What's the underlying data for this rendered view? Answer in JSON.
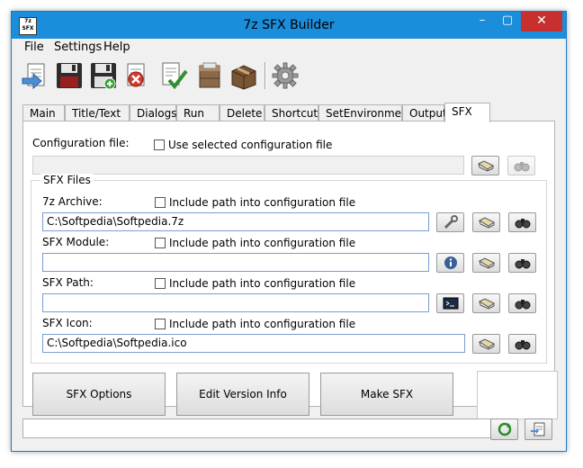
{
  "window": {
    "title": "7z SFX Builder",
    "app_icon_text": "7z SFX"
  },
  "titlebar_buttons": {
    "minimize": "–",
    "maximize": "▢",
    "close": "✕"
  },
  "menu": [
    {
      "label": "File"
    },
    {
      "label": "Settings"
    },
    {
      "label": "Help"
    }
  ],
  "toolbar": [
    {
      "icon": "open-icon"
    },
    {
      "icon": "save-icon"
    },
    {
      "icon": "save-new-icon"
    },
    {
      "icon": "delete-icon"
    },
    {
      "icon": "check-icon"
    },
    {
      "icon": "archive-box-icon"
    },
    {
      "icon": "sfx-box-icon"
    },
    {
      "icon": "settings-gear-icon"
    }
  ],
  "tabs": [
    {
      "label": "Main"
    },
    {
      "label": "Title/Text"
    },
    {
      "label": "Dialogs"
    },
    {
      "label": "Run"
    },
    {
      "label": "Delete"
    },
    {
      "label": "Shortcuts"
    },
    {
      "label": "SetEnvironment"
    },
    {
      "label": "Output"
    },
    {
      "label": "SFX",
      "active": true
    }
  ],
  "config": {
    "label": "Configuration file:",
    "use_selected_label": "Use selected configuration file",
    "value": ""
  },
  "sfx_files": {
    "group_title": "SFX Files",
    "include_path_label": "Include path into configuration file",
    "archive": {
      "label": "7z Archive:",
      "value": "C:\\Softpedia\\Softpedia.7z"
    },
    "module": {
      "label": "SFX Module:",
      "value": ""
    },
    "path": {
      "label": "SFX Path:",
      "value": ""
    },
    "icon": {
      "label": "SFX Icon:",
      "value": "C:\\Softpedia\\Softpedia.ico"
    }
  },
  "buttons": {
    "sfx_options": "SFX Options",
    "edit_version_info": "Edit Version Info",
    "make_sfx": "Make SFX"
  },
  "status": {
    "text": ""
  },
  "colors": {
    "titlebar": "#1a8ddb",
    "close": "#c7302e",
    "field_border": "#7a9cd3"
  }
}
